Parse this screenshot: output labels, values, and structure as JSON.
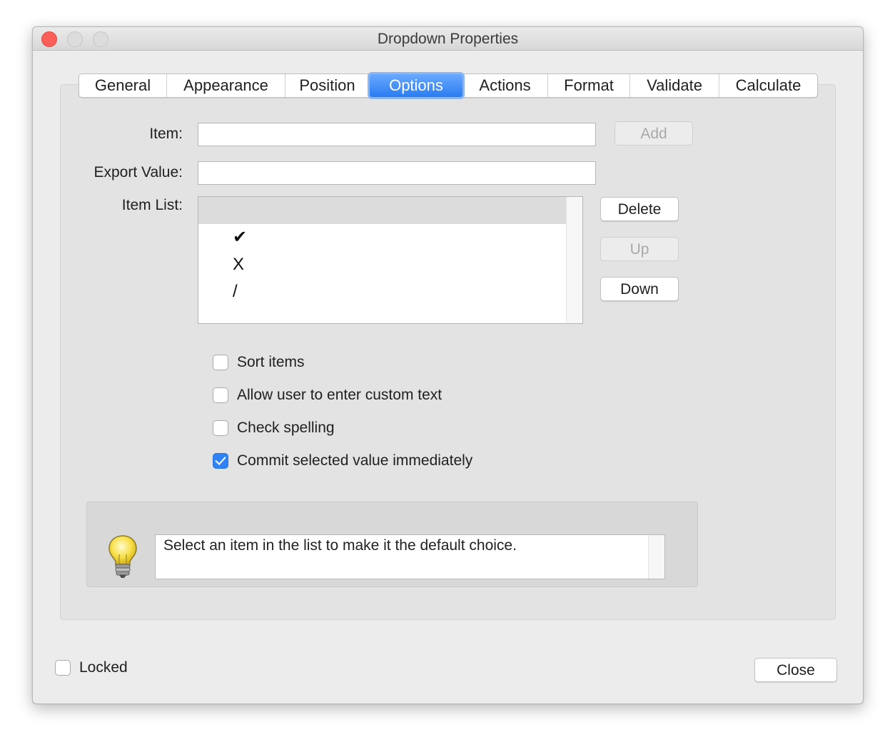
{
  "window": {
    "title": "Dropdown Properties"
  },
  "tabs": [
    {
      "label": "General"
    },
    {
      "label": "Appearance"
    },
    {
      "label": "Position"
    },
    {
      "label": "Options",
      "active": true
    },
    {
      "label": "Actions"
    },
    {
      "label": "Format"
    },
    {
      "label": "Validate"
    },
    {
      "label": "Calculate"
    }
  ],
  "options": {
    "item_label": "Item:",
    "item_value": "",
    "export_label": "Export Value:",
    "export_value": "",
    "list_label": "Item List:",
    "list_items": [
      "",
      "✔",
      "X",
      "/"
    ],
    "buttons": {
      "add": "Add",
      "delete": "Delete",
      "up": "Up",
      "down": "Down"
    },
    "checkboxes": [
      {
        "label": "Sort items",
        "checked": false
      },
      {
        "label": "Allow user to enter custom text",
        "checked": false
      },
      {
        "label": "Check spelling",
        "checked": false
      },
      {
        "label": "Commit selected value immediately",
        "checked": true
      }
    ],
    "hint": "Select an item in the list to make it the default choice."
  },
  "footer": {
    "locked_label": "Locked",
    "locked_checked": false,
    "close_label": "Close"
  },
  "colors": {
    "accent": "#2f83f5",
    "close_light": "#fc5f57"
  }
}
